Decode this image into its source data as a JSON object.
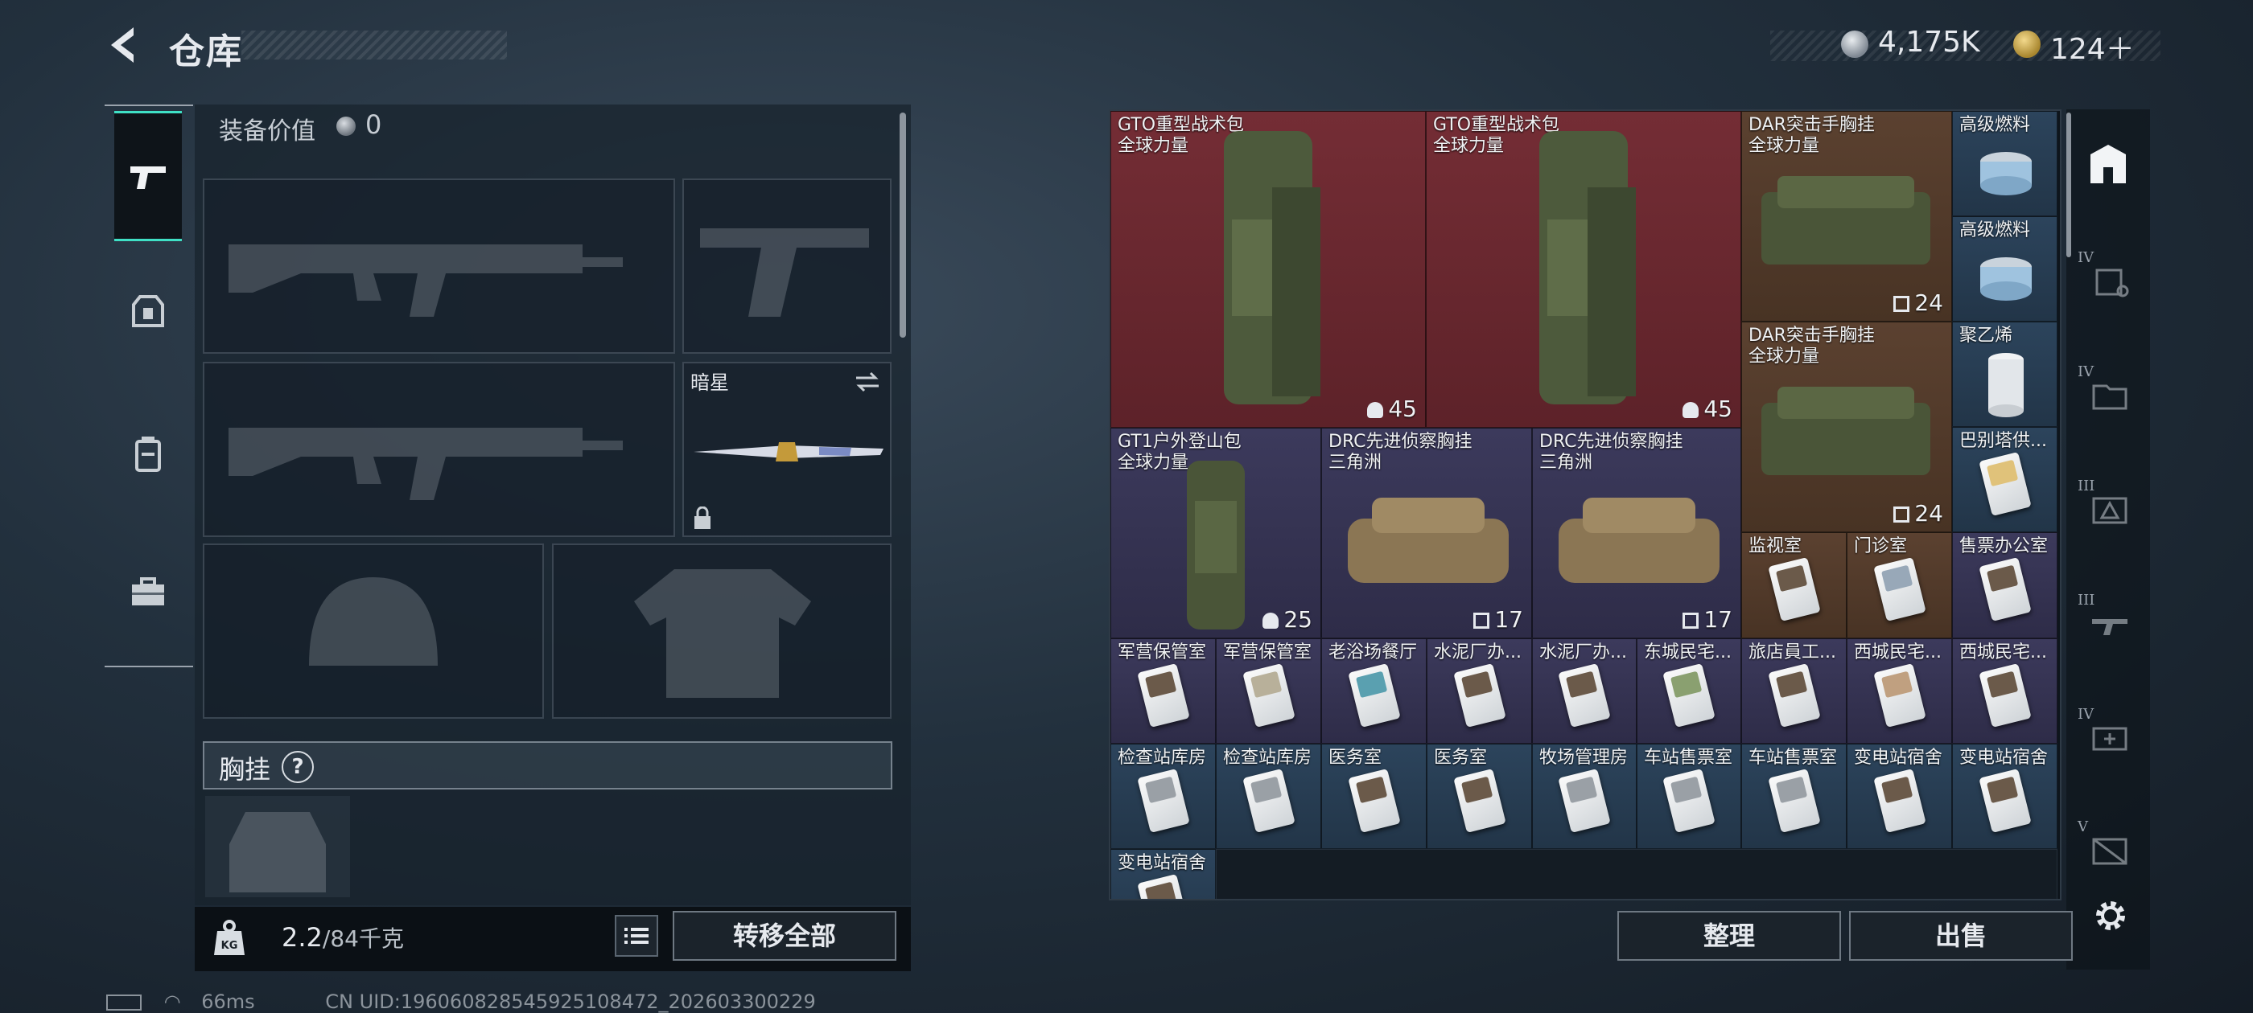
{
  "header": {
    "title": "仓库",
    "money": "4,175K",
    "premium": "124＋"
  },
  "equipment": {
    "value_label": "装备价值",
    "value": "0",
    "melee_name": "暗星",
    "chest_rig_label": "胸挂",
    "chest_help": "?"
  },
  "footer_left": {
    "weight_current": "2.2",
    "weight_max": "/84千克",
    "transfer_all": "转移全部"
  },
  "stash": {
    "items": [
      {
        "name1": "GTO重型战术包",
        "name2": "全球力量",
        "cap": "45"
      },
      {
        "name1": "GTO重型战术包",
        "name2": "全球力量",
        "cap": "45"
      },
      {
        "name1": "DAR突击手胸挂",
        "name2": "全球力量",
        "cap": "24"
      },
      {
        "name1": "高级燃料"
      },
      {
        "name1": "高级燃料"
      },
      {
        "name1": "DAR突击手胸挂",
        "name2": "全球力量",
        "cap": "24"
      },
      {
        "name1": "聚乙烯"
      },
      {
        "name1": "GT1户外登山包",
        "name2": "全球力量",
        "cap": "25"
      },
      {
        "name1": "DRC先进侦察胸挂",
        "name2": "三角洲",
        "cap": "17"
      },
      {
        "name1": "DRC先进侦察胸挂",
        "name2": "三角洲",
        "cap": "17"
      },
      {
        "name1": "巴别塔供..."
      },
      {
        "name1": "监视室"
      },
      {
        "name1": "门诊室"
      },
      {
        "name1": "售票办公室"
      },
      {
        "name1": "军营保管室"
      },
      {
        "name1": "军营保管室"
      },
      {
        "name1": "老浴场餐厅"
      },
      {
        "name1": "水泥厂办..."
      },
      {
        "name1": "水泥厂办..."
      },
      {
        "name1": "东城民宅..."
      },
      {
        "name1": "旅店員工..."
      },
      {
        "name1": "西城民宅..."
      },
      {
        "name1": "西城民宅..."
      },
      {
        "name1": "检查站库房"
      },
      {
        "name1": "检查站库房"
      },
      {
        "name1": "医务室"
      },
      {
        "name1": "医务室"
      },
      {
        "name1": "牧场管理房"
      },
      {
        "name1": "车站售票室"
      },
      {
        "name1": "车站售票室"
      },
      {
        "name1": "变电站宿舍"
      },
      {
        "name1": "变电站宿舍"
      },
      {
        "name1": "变电站宿舍"
      }
    ]
  },
  "footer_right": {
    "sort": "整理",
    "sell": "出售"
  },
  "status": {
    "ping": "66ms",
    "uid": "CN UID:1960608285459251084​72_202603300229"
  },
  "tiers": [
    "IV",
    "IV",
    "III",
    "III",
    "IV",
    "V"
  ]
}
